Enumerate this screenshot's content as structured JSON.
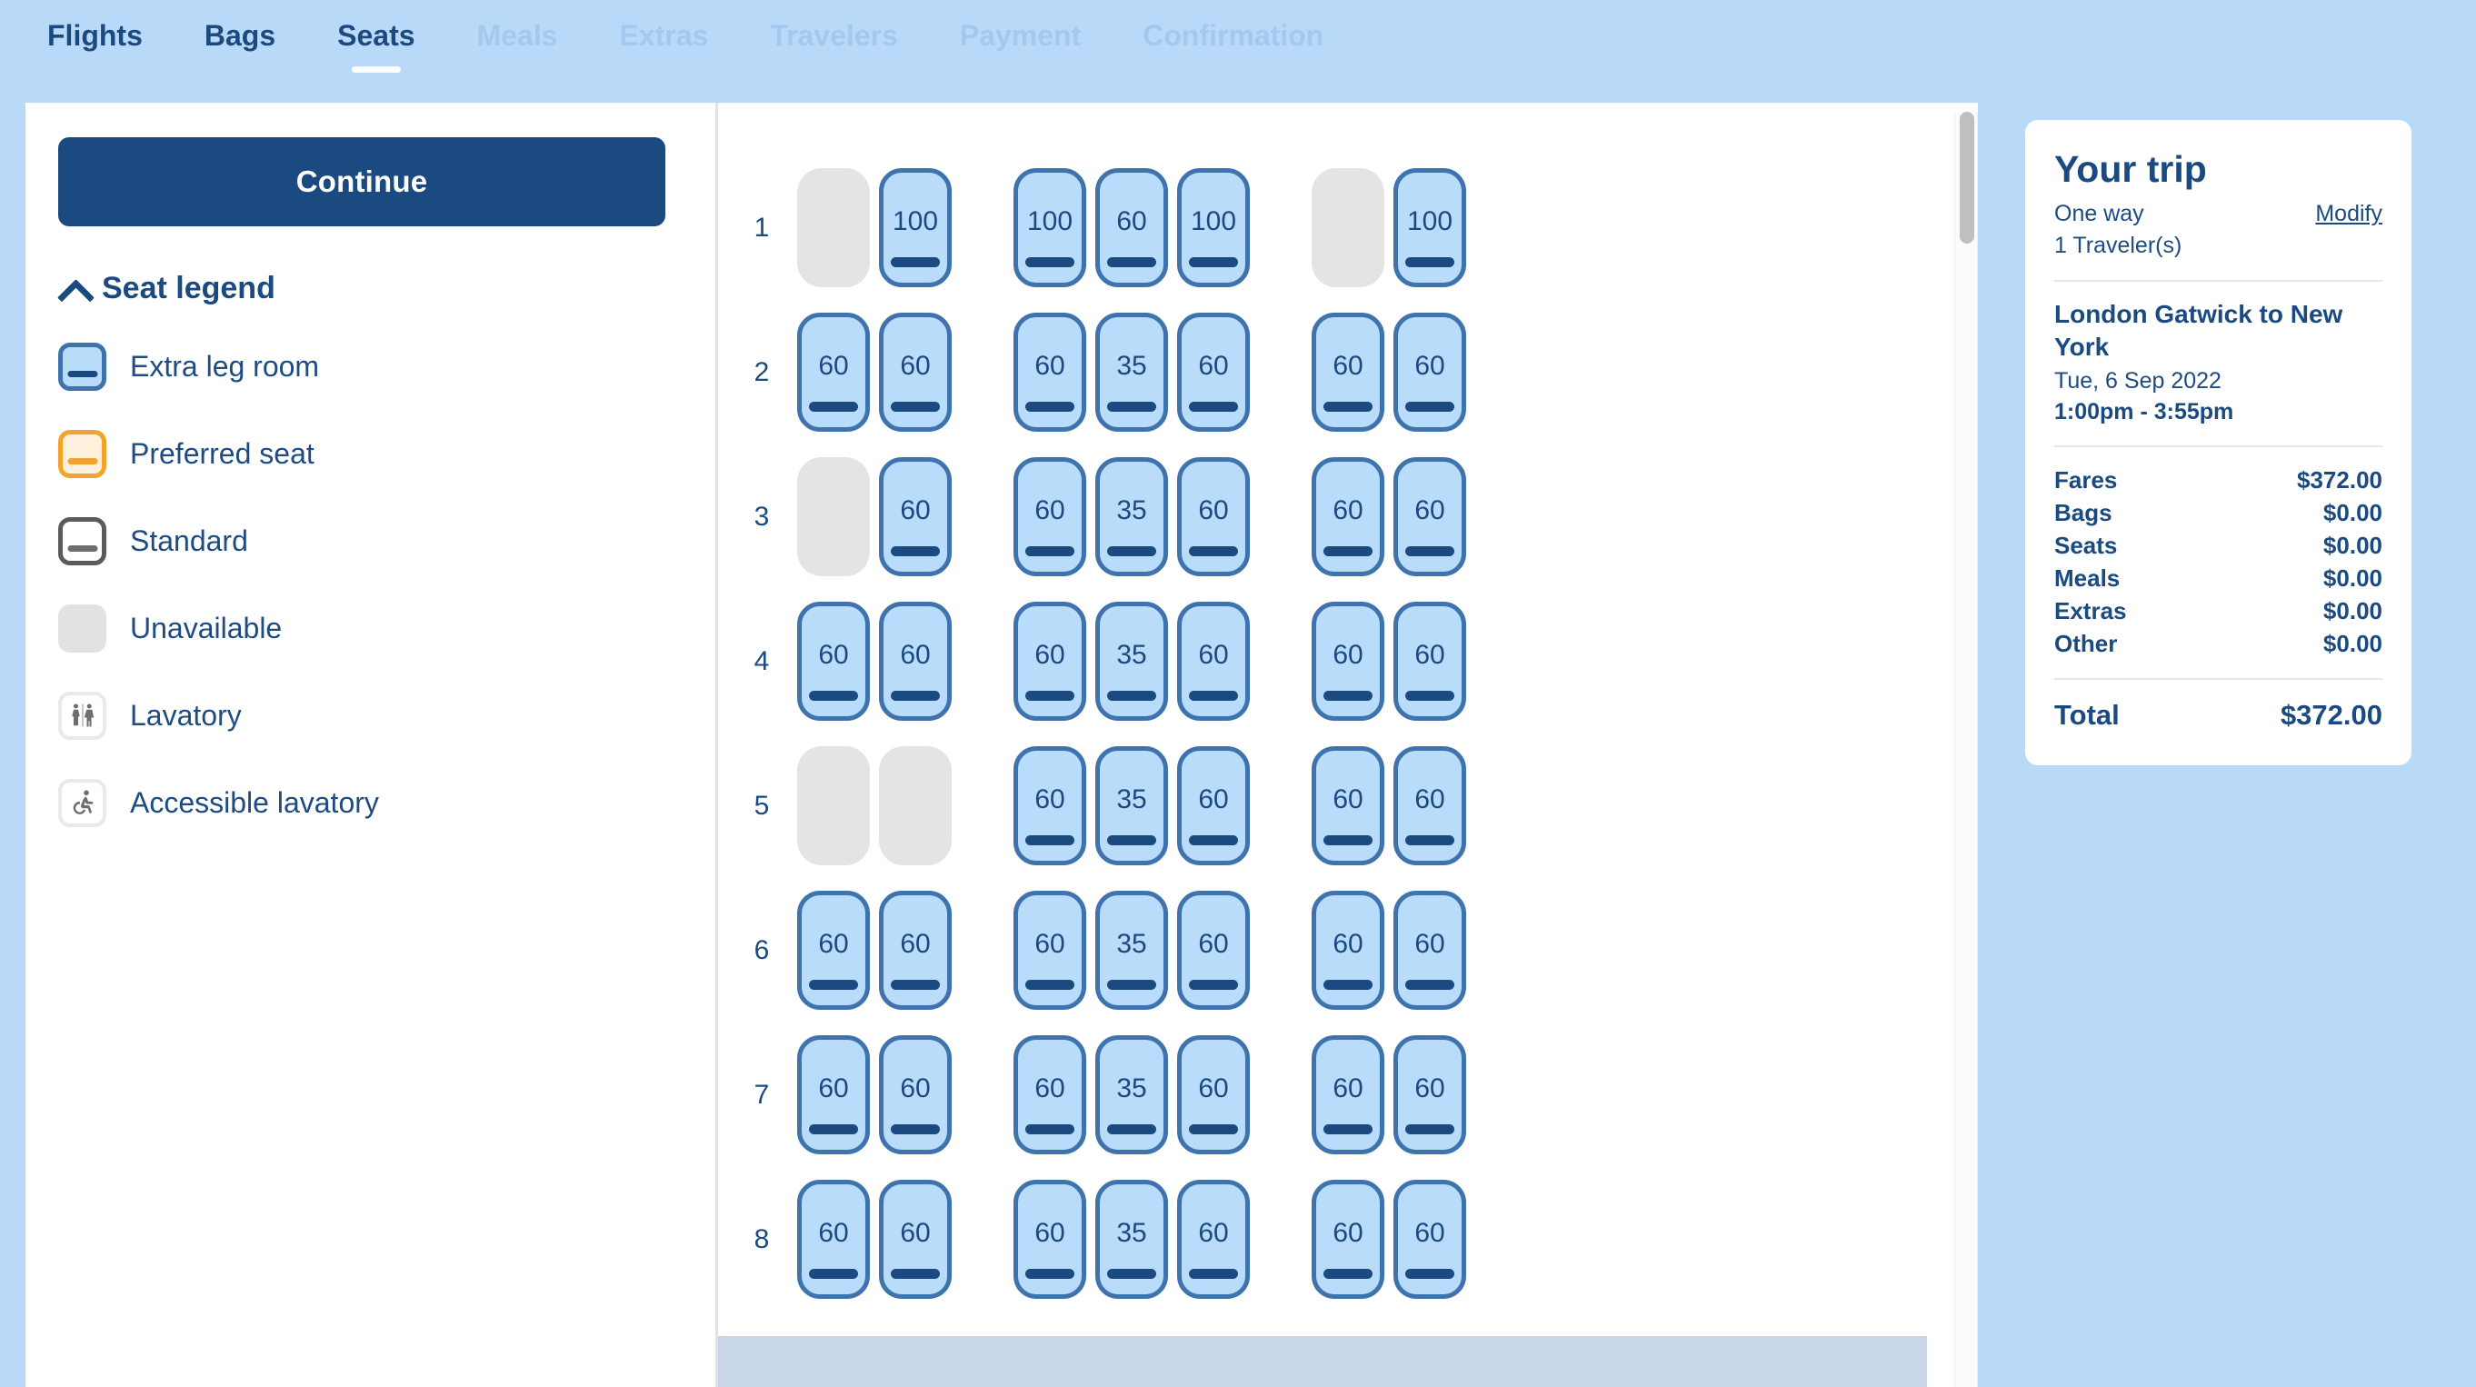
{
  "nav": {
    "tabs": [
      {
        "label": "Flights",
        "state": "done"
      },
      {
        "label": "Bags",
        "state": "done"
      },
      {
        "label": "Seats",
        "state": "active"
      },
      {
        "label": "Meals",
        "state": "upcoming"
      },
      {
        "label": "Extras",
        "state": "upcoming"
      },
      {
        "label": "Travelers",
        "state": "upcoming"
      },
      {
        "label": "Payment",
        "state": "upcoming"
      },
      {
        "label": "Confirmation",
        "state": "upcoming"
      }
    ]
  },
  "sidebar": {
    "continue_label": "Continue",
    "legend_title": "Seat legend",
    "legend_items": [
      {
        "label": "Extra leg room",
        "kind": "extralegroom"
      },
      {
        "label": "Preferred seat",
        "kind": "preferred"
      },
      {
        "label": "Standard",
        "kind": "standard"
      },
      {
        "label": "Unavailable",
        "kind": "unavailable"
      },
      {
        "label": "Lavatory",
        "kind": "lavatory"
      },
      {
        "label": "Accessible lavatory",
        "kind": "accessible"
      }
    ]
  },
  "seatmap": {
    "rows": [
      {
        "row": "1",
        "left": [
          "",
          "100"
        ],
        "middle": [
          "100",
          "60",
          "100"
        ],
        "right": [
          "",
          "100"
        ]
      },
      {
        "row": "2",
        "left": [
          "60",
          "60"
        ],
        "middle": [
          "60",
          "35",
          "60"
        ],
        "right": [
          "60",
          "60"
        ]
      },
      {
        "row": "3",
        "left": [
          "",
          "60"
        ],
        "middle": [
          "60",
          "35",
          "60"
        ],
        "right": [
          "60",
          "60"
        ]
      },
      {
        "row": "4",
        "left": [
          "60",
          "60"
        ],
        "middle": [
          "60",
          "35",
          "60"
        ],
        "right": [
          "60",
          "60"
        ]
      },
      {
        "row": "5",
        "left": [
          "",
          ""
        ],
        "middle": [
          "60",
          "35",
          "60"
        ],
        "right": [
          "60",
          "60"
        ]
      },
      {
        "row": "6",
        "left": [
          "60",
          "60"
        ],
        "middle": [
          "60",
          "35",
          "60"
        ],
        "right": [
          "60",
          "60"
        ]
      },
      {
        "row": "7",
        "left": [
          "60",
          "60"
        ],
        "middle": [
          "60",
          "35",
          "60"
        ],
        "right": [
          "60",
          "60"
        ]
      },
      {
        "row": "8",
        "left": [
          "60",
          "60"
        ],
        "middle": [
          "60",
          "35",
          "60"
        ],
        "right": [
          "60",
          "60"
        ]
      }
    ]
  },
  "trip": {
    "title": "Your trip",
    "type": "One way",
    "modify_label": "Modify",
    "travelers": "1 Traveler(s)",
    "route": "London Gatwick to New York",
    "date": "Tue, 6 Sep 2022",
    "times": "1:00pm - 3:55pm",
    "prices": [
      {
        "label": "Fares",
        "value": "$372.00"
      },
      {
        "label": "Bags",
        "value": "$0.00"
      },
      {
        "label": "Seats",
        "value": "$0.00"
      },
      {
        "label": "Meals",
        "value": "$0.00"
      },
      {
        "label": "Extras",
        "value": "$0.00"
      },
      {
        "label": "Other",
        "value": "$0.00"
      }
    ],
    "total_label": "Total",
    "total_value": "$372.00"
  },
  "colors": {
    "page_bg": "#b9d9f8",
    "brand_navy": "#1b4a80",
    "seat_fill": "#badcfb",
    "seat_border": "#3f73ad",
    "unavailable": "#e4e4e4",
    "preferred": "#f2a32c"
  }
}
